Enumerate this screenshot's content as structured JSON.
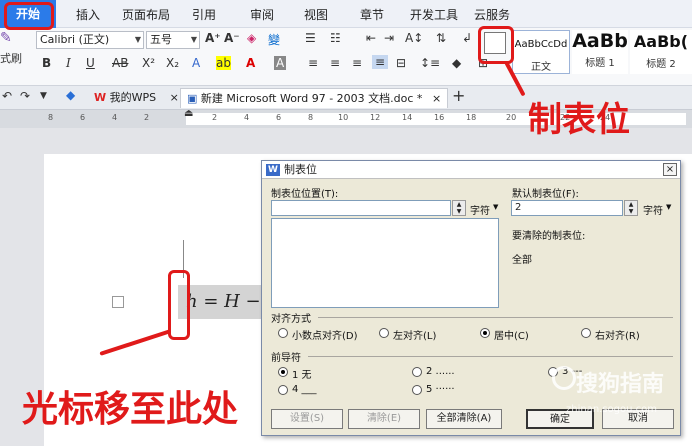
{
  "menu": {
    "items": [
      "开始",
      "插入",
      "页面布局",
      "引用",
      "审阅",
      "视图",
      "章节",
      "开发工具",
      "云服务"
    ]
  },
  "ribbon": {
    "font_name": "Calibri (正文)",
    "font_size": "五号",
    "left_cut_label": "式刷",
    "styles": [
      {
        "preview": "AaBbCcDd",
        "label": "正文"
      },
      {
        "preview": "AaBb",
        "label": "标题 1"
      },
      {
        "preview": "AaBb(",
        "label": "标题 2"
      }
    ]
  },
  "tabs": {
    "wps_tab": "我的WPS",
    "doc_tab": "新建 Microsoft Word 97 - 2003 文档.doc *",
    "new_tab": "+"
  },
  "ruler": {
    "numbers": [
      "8",
      "6",
      "4",
      "2",
      "2",
      "4",
      "6",
      "8",
      "10",
      "12",
      "14",
      "16",
      "18",
      "20",
      "22",
      "24"
    ]
  },
  "document": {
    "formula": "h = H −"
  },
  "dialog": {
    "title": "制表位",
    "tab_position_label": "制表位位置(T):",
    "tab_position_value": "",
    "unit_left": "字符",
    "default_tab_label": "默认制表位(F):",
    "default_tab_value": "2",
    "unit_right": "字符",
    "to_clear_label": "要清除的制表位:",
    "to_clear_value": "全部",
    "alignment_label": "对齐方式",
    "alignment_options": [
      {
        "label": "小数点对齐(D)",
        "checked": false
      },
      {
        "label": "左对齐(L)",
        "checked": false
      },
      {
        "label": "居中(C)",
        "checked": true
      },
      {
        "label": "右对齐(R)",
        "checked": false
      }
    ],
    "leader_label": "前导符",
    "leader_options": [
      {
        "label": "1 无",
        "checked": true
      },
      {
        "label": "2 ......",
        "checked": false
      },
      {
        "label": "3 ---",
        "checked": false
      },
      {
        "label": "4 ___",
        "checked": false
      },
      {
        "label": "5 ······",
        "checked": false
      }
    ],
    "buttons": {
      "set": "设置(S)",
      "clear": "清除(E)",
      "clear_all": "全部清除(A)",
      "ok": "确定",
      "cancel": "取消"
    },
    "close": "×"
  },
  "annotations": {
    "tab_stop_callout": "制表位",
    "cursor_callout": "光标移至此处",
    "color": "#e01a1a"
  },
  "watermark": {
    "text": "搜狗指南",
    "url": "zhinan.sogou.com"
  }
}
